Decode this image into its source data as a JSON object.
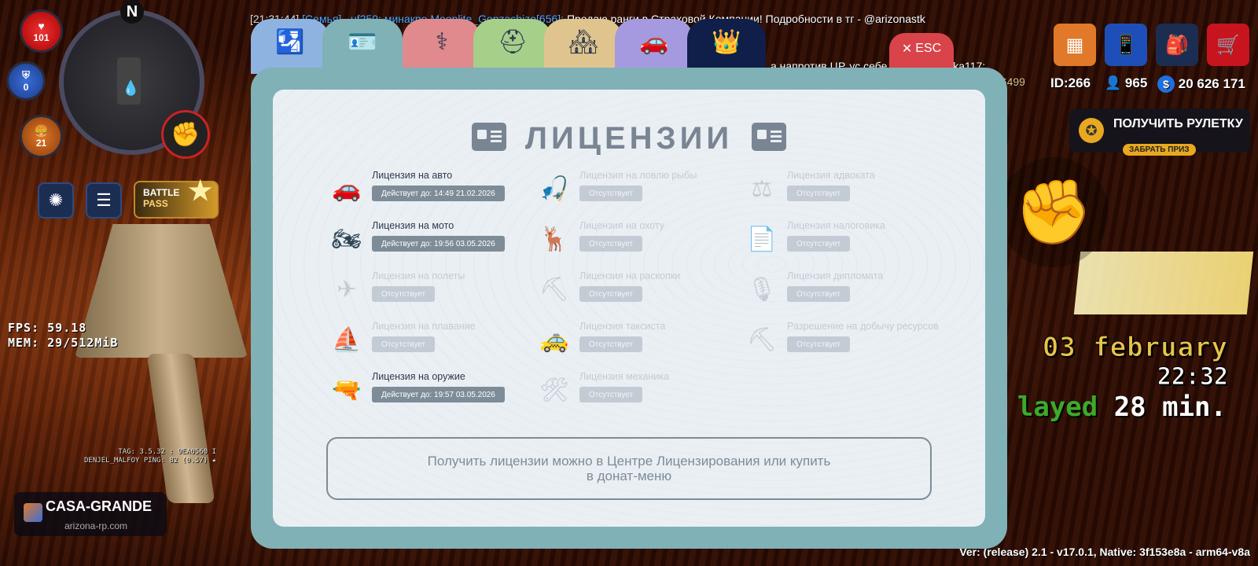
{
  "hud": {
    "health": "101",
    "armor": "0",
    "hunger": "21",
    "compass": "N",
    "battle_pass": {
      "line1": "BATTLE",
      "line2": "PASS"
    },
    "fps_label": "FPS:",
    "fps_value": "59.18",
    "mem_label": "MEM:",
    "mem_value": "29/512MiB",
    "tag_line": "TAG: 3.5.32 : 9EA0560 I",
    "player_line": "DENJEL_MALFOY    PING: 82 (0.57) ★",
    "server_name": "CASA-GRANDE",
    "server_site": "arizona-rp.com"
  },
  "chat": {
    "line1_time": "[21:31:44]",
    "line1_who": "[Семья] ..uf259: минакро Moonlite_Gonzashizo[656]:",
    "line1_text": "Продаю ранги в Страховой Компании! Подробности в тг - @arizonastk",
    "line2_text": "а напротив ЦР, ус        себе ресурсы :lavka117:",
    "line3_text": "86499"
  },
  "right_hud": {
    "id_label": "ID:266",
    "online": "965",
    "money": "20 626 171",
    "roulette_title": "ПОЛУЧИТЬ РУЛЕТКУ",
    "roulette_prize": "ЗАБРАТЬ ПРИЗ",
    "date": "03 february",
    "time": "22:32",
    "played_1": "layed",
    "played_2": "28 min.",
    "version": "Ver: (release) 2.1 - v17.0.1, Native: 3f153e8a - arm64-v8a"
  },
  "menu": {
    "esc_label": "ESC",
    "title": "ЛИЦЕНЗИИ",
    "info": "Получить лицензии можно в Центре Лицензирования или купить в донат-меню",
    "tabs": [
      {
        "name": "passport",
        "color": "#8fb3e0",
        "icon": "passport-icon",
        "glyph": "🛂"
      },
      {
        "name": "licenses",
        "color": "#7fb1b7",
        "icon": "id-card-icon",
        "glyph": "🪪"
      },
      {
        "name": "medical",
        "color": "#e08a8e",
        "icon": "medical-icon",
        "glyph": "⚕"
      },
      {
        "name": "military",
        "color": "#a6cf8a",
        "icon": "helmet-icon",
        "glyph": "⛑"
      },
      {
        "name": "property",
        "color": "#e0c48e",
        "icon": "houses-icon",
        "glyph": "🏘"
      },
      {
        "name": "vehicles",
        "color": "#a59ae0",
        "icon": "car-icon",
        "glyph": "🚗"
      },
      {
        "name": "donate",
        "color": "#0f1f4a",
        "icon": "crown-icon",
        "glyph": "👑"
      }
    ],
    "licenses": [
      {
        "name": "Лицензия на авто",
        "status": "Действует до: 14:49 21.02.2026",
        "active": true,
        "icon": "car-icon",
        "glyph": "🚗"
      },
      {
        "name": "Лицензия на ловлю рыбы",
        "status": "Отсутствует",
        "active": false,
        "icon": "fish-hook-icon",
        "glyph": "🎣"
      },
      {
        "name": "Лицензия адвоката",
        "status": "Отсутствует",
        "active": false,
        "icon": "gavel-icon",
        "glyph": "⚖"
      },
      {
        "name": "Лицензия на мото",
        "status": "Действует до: 19:56 03.05.2026",
        "active": true,
        "icon": "motorcycle-icon",
        "glyph": "🏍"
      },
      {
        "name": "Лицензия на охоту",
        "status": "Отсутствует",
        "active": false,
        "icon": "deer-icon",
        "glyph": "🦌"
      },
      {
        "name": "Лицензия налоговика",
        "status": "Отсутствует",
        "active": false,
        "icon": "tax-document-icon",
        "glyph": "📄"
      },
      {
        "name": "Лицензия на полеты",
        "status": "Отсутствует",
        "active": false,
        "icon": "airplane-icon",
        "glyph": "✈"
      },
      {
        "name": "Лицензия на раскопки",
        "status": "Отсутствует",
        "active": false,
        "icon": "shovel-icon",
        "glyph": "⛏"
      },
      {
        "name": "Лицензия дипломата",
        "status": "Отсутствует",
        "active": false,
        "icon": "diplomat-icon",
        "glyph": "🎙"
      },
      {
        "name": "Лицензия на плавание",
        "status": "Отсутствует",
        "active": false,
        "icon": "sailboat-icon",
        "glyph": "⛵"
      },
      {
        "name": "Лицензия таксиста",
        "status": "Отсутствует",
        "active": false,
        "icon": "taxi-icon",
        "glyph": "🚕"
      },
      {
        "name": "Разрешение на добычу ресурсов",
        "status": "Отсутствует",
        "active": false,
        "icon": "pickaxe-icon",
        "glyph": "⛏"
      },
      {
        "name": "Лицензия на оружие",
        "status": "Действует до: 19:57 03.05.2026",
        "active": true,
        "icon": "pistol-icon",
        "glyph": "🔫"
      },
      {
        "name": "Лицензия механика",
        "status": "Отсутствует",
        "active": false,
        "icon": "tools-icon",
        "glyph": "🛠"
      }
    ]
  }
}
